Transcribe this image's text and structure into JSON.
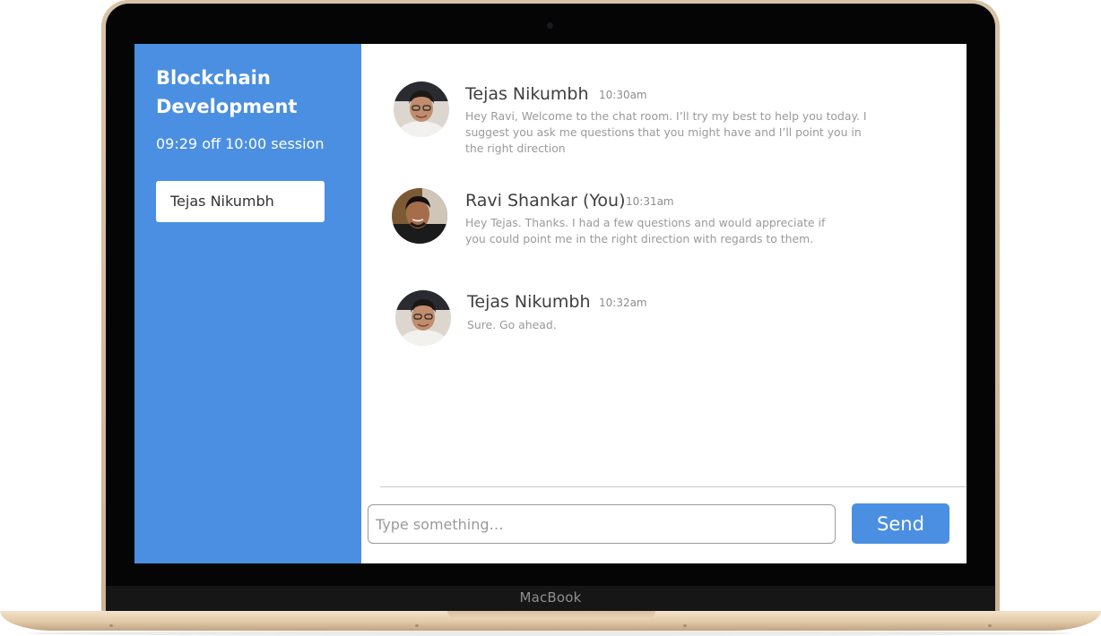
{
  "device": {
    "brand_label": "MacBook"
  },
  "sidebar": {
    "title": "Blockchain Development",
    "session_time": "09:29 off 10:00 session",
    "participants": [
      {
        "name": "Tejas Nikumbh"
      }
    ],
    "background_color": "#4a8fe2"
  },
  "chat": {
    "messages": [
      {
        "author": "Tejas Nikumbh",
        "time": "10:30am",
        "text": "Hey Ravi, Welcome to the chat room. I’ll try my best to help you today. I suggest you ask me questions that you might have and I’ll point you in the right direction",
        "avatar": "user-avatar-tejas"
      },
      {
        "author": "Ravi Shankar (You)",
        "time": "10:31am",
        "text": "Hey Tejas. Thanks. I had a few questions and would appreciate if you could point me in the right direction with regards to them.",
        "avatar": "user-avatar-ravi"
      },
      {
        "author": "Tejas Nikumbh",
        "time": "10:32am",
        "text": "Sure. Go ahead.",
        "avatar": "user-avatar-tejas"
      }
    ]
  },
  "composer": {
    "placeholder": "Type something…",
    "value": "",
    "send_label": "Send",
    "accent_color": "#4a8fe2"
  }
}
